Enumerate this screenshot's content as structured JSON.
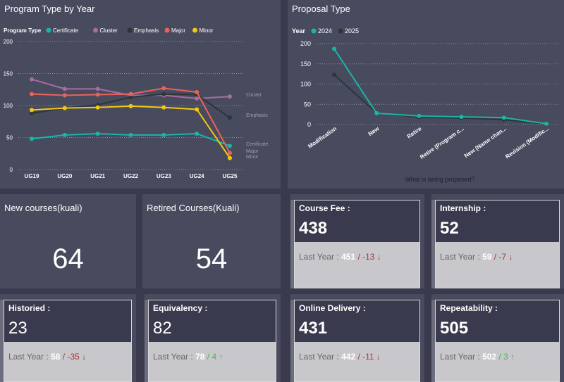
{
  "line_chart": {
    "title": "Program Type by Year",
    "legend_title": "Program Type",
    "chart_data": {
      "type": "line",
      "x": [
        "UG19",
        "UG20",
        "UG21",
        "UG22",
        "UG23",
        "UG24",
        "UG25"
      ],
      "ylim": [
        0,
        200
      ],
      "yticks": [
        0,
        50,
        100,
        150,
        200
      ],
      "series": [
        {
          "name": "Certificate",
          "color": "#1ab5a8",
          "values": [
            48,
            54,
            56,
            54,
            54,
            56,
            37
          ]
        },
        {
          "name": "Cluster",
          "color": "#a56ea1",
          "values": [
            141,
            126,
            126,
            116,
            116,
            111,
            114
          ]
        },
        {
          "name": "Emphasis",
          "color": "#2c3638",
          "values": [
            88,
            96,
            101,
            113,
            118,
            117,
            81
          ]
        },
        {
          "name": "Major",
          "color": "#e8635b",
          "values": [
            118,
            116,
            117,
            118,
            127,
            121,
            26
          ]
        },
        {
          "name": "Minor",
          "color": "#f2c811",
          "values": [
            93,
            96,
            97,
            99,
            97,
            94,
            18
          ]
        }
      ],
      "end_labels": [
        "Cluster",
        "Emphasis",
        "Certificate",
        "Major",
        "Minor"
      ]
    }
  },
  "proposal_chart": {
    "title": "Proposal Type",
    "legend_title": "Year",
    "chart_data": {
      "type": "line",
      "categories": [
        "Modification",
        "New",
        "Retire",
        "Retire (Program c...",
        "New (Name chan...",
        "Revision (Modific..."
      ],
      "xlabel": "What is being proposed?",
      "ylim": [
        0,
        200
      ],
      "yticks": [
        0,
        50,
        100,
        150,
        200
      ],
      "series": [
        {
          "name": "2024",
          "color": "#1ab5a8",
          "values": [
            187,
            28,
            21,
            19,
            17,
            2
          ]
        },
        {
          "name": "2025",
          "color": "#2c3638",
          "values": [
            123,
            29,
            18,
            16,
            12,
            2
          ]
        }
      ]
    }
  },
  "cards": {
    "new_courses": {
      "label": "New courses(kuali)",
      "value": "64"
    },
    "retired_courses": {
      "label": "Retired Courses(Kuali)",
      "value": "54"
    }
  },
  "kpis": {
    "course_fee": {
      "label": "Course Fee :",
      "value": "438",
      "last_label": "Last Year :",
      "last_value": "451",
      "sep": "/",
      "delta": "-13",
      "arrow": "↓"
    },
    "internship": {
      "label": "Internship :",
      "value": "52",
      "last_label": "Last Year :",
      "last_value": "59",
      "sep": "/",
      "delta": "-7",
      "arrow": "↓"
    },
    "historied": {
      "label": "Historied :",
      "value": "23",
      "last_label": "Last Year :",
      "last_value": "58",
      "sep": "/",
      "delta": "-35",
      "arrow": "↓"
    },
    "equivalency": {
      "label": "Equivalency :",
      "value": "82",
      "last_label": "Last Year :",
      "last_value": "78",
      "sep": "/",
      "delta": "4",
      "arrow": "↑"
    },
    "online_delivery": {
      "label": "Online Delivery :",
      "value": "431",
      "last_label": "Last Year :",
      "last_value": "442",
      "sep": "/",
      "delta": "-11",
      "arrow": "↓"
    },
    "repeatability": {
      "label": "Repeatability :",
      "value": "505",
      "last_label": "Last Year :",
      "last_value": "502",
      "sep": "/",
      "delta": "3",
      "arrow": "↑"
    }
  }
}
